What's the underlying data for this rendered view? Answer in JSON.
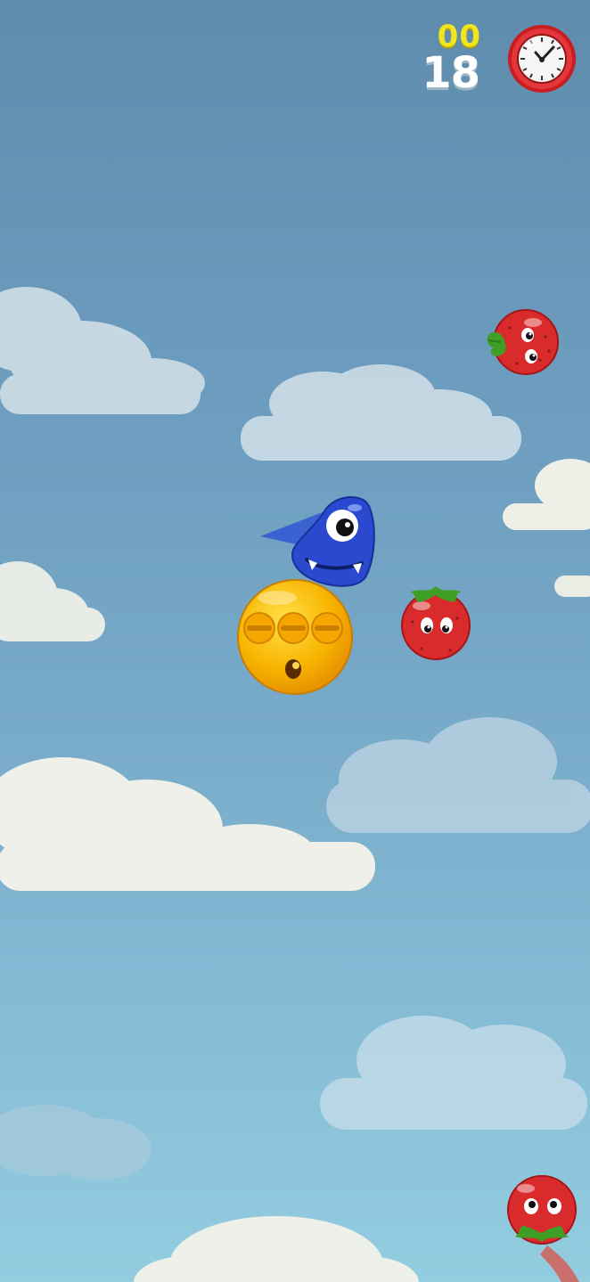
{
  "game": {
    "hud": {
      "coin_counter": "00",
      "score": "18",
      "timer_icon": "stopwatch-icon"
    },
    "player": {
      "name_icon": "blue-monster-icon",
      "color": "#2a49cf"
    },
    "enemies": [
      {
        "kind": "tomato-icon",
        "color": "#d32428"
      },
      {
        "kind": "tomato-icon",
        "color": "#d32428"
      },
      {
        "kind": "tomato-icon",
        "color": "#d32428"
      }
    ],
    "bubble": {
      "kind": "yellow-face-bubble-icon",
      "color": "#f7b500"
    },
    "sky_colors": {
      "top": "#5f8cad",
      "bottom": "#93cde0"
    }
  }
}
